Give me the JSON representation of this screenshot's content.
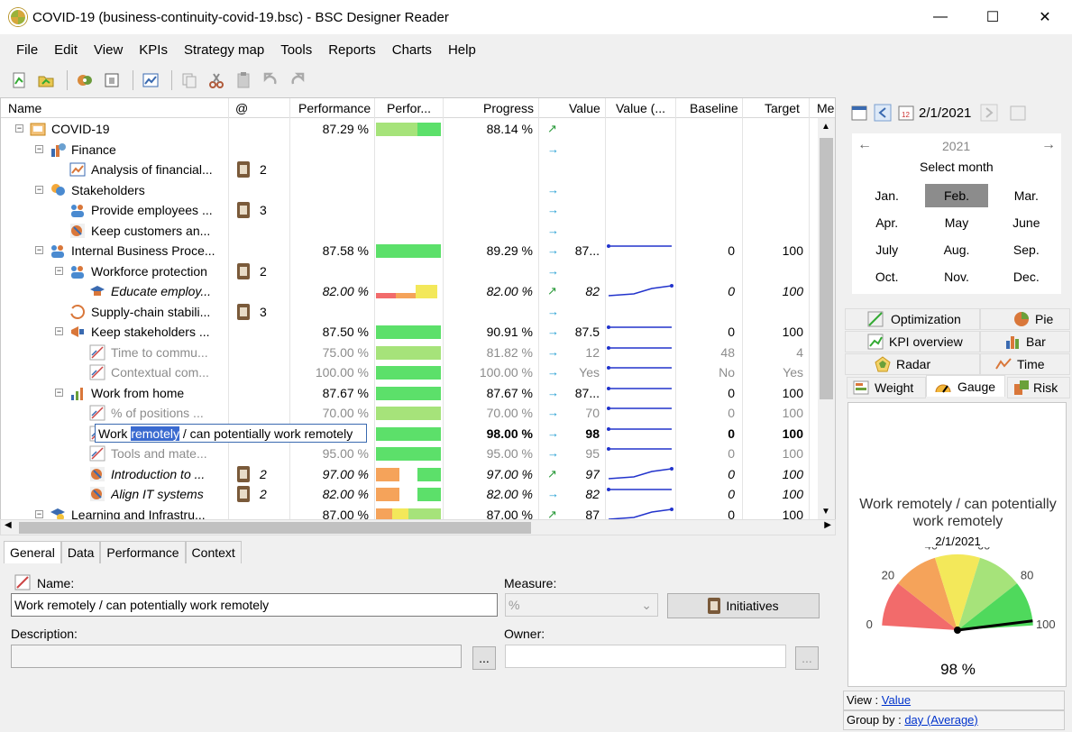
{
  "window": {
    "title": "COVID-19 (business-continuity-covid-19.bsc) - BSC Designer Reader",
    "controls": {
      "minimize": "—",
      "maximize": "☐",
      "close": "✕"
    }
  },
  "menu": [
    "File",
    "Edit",
    "View",
    "KPIs",
    "Strategy map",
    "Tools",
    "Reports",
    "Charts",
    "Help"
  ],
  "grid": {
    "headers": {
      "name": "Name",
      "at": "@",
      "performance": "Performance",
      "perf_bar": "Perfor...",
      "progress": "Progress",
      "value": "Value",
      "value_chart": "Value (...",
      "baseline": "Baseline",
      "target": "Target",
      "measure": "Mea"
    },
    "rows": [
      {
        "name": "COVID-19",
        "performance": "87.29 %",
        "progress": "88.14 %",
        "arrow": "↗",
        "value": "",
        "baseline": "",
        "target": "",
        "count": ""
      },
      {
        "name": "Finance",
        "performance": "",
        "progress": "",
        "arrow": "→",
        "value": "",
        "baseline": "",
        "target": "",
        "count": ""
      },
      {
        "name": "Analysis of financial...",
        "performance": "",
        "progress": "",
        "arrow": "",
        "value": "",
        "baseline": "",
        "target": "",
        "count": "2"
      },
      {
        "name": "Stakeholders",
        "performance": "",
        "progress": "",
        "arrow": "→",
        "value": "",
        "baseline": "",
        "target": "",
        "count": ""
      },
      {
        "name": "Provide employees ...",
        "performance": "",
        "progress": "",
        "arrow": "→",
        "value": "",
        "baseline": "",
        "target": "",
        "count": "3"
      },
      {
        "name": "Keep customers an...",
        "performance": "",
        "progress": "",
        "arrow": "→",
        "value": "",
        "baseline": "",
        "target": "",
        "count": ""
      },
      {
        "name": "Internal Business Proce...",
        "performance": "87.58 %",
        "progress": "89.29 %",
        "arrow": "→",
        "value": "87...",
        "baseline": "0",
        "target": "100",
        "count": ""
      },
      {
        "name": "Workforce protection",
        "performance": "",
        "progress": "",
        "arrow": "→",
        "value": "",
        "baseline": "",
        "target": "",
        "count": "2"
      },
      {
        "name": "Educate employ...",
        "performance": "82.00 %",
        "progress": "82.00 %",
        "arrow": "↗",
        "value": "82",
        "baseline": "0",
        "target": "100",
        "count": ""
      },
      {
        "name": "Supply-chain stabili...",
        "performance": "",
        "progress": "",
        "arrow": "→",
        "value": "",
        "baseline": "",
        "target": "",
        "count": "3"
      },
      {
        "name": "Keep stakeholders ...",
        "performance": "87.50 %",
        "progress": "90.91 %",
        "arrow": "→",
        "value": "87.5",
        "baseline": "0",
        "target": "100",
        "count": ""
      },
      {
        "name": "Time to commu...",
        "performance": "75.00 %",
        "progress": "81.82 %",
        "arrow": "→",
        "value": "12",
        "baseline": "48",
        "target": "4",
        "count": ""
      },
      {
        "name": "Contextual com...",
        "performance": "100.00 %",
        "progress": "100.00 %",
        "arrow": "→",
        "value": "Yes",
        "baseline": "No",
        "target": "Yes",
        "count": ""
      },
      {
        "name": "Work from home",
        "performance": "87.67 %",
        "progress": "87.67 %",
        "arrow": "→",
        "value": "87...",
        "baseline": "0",
        "target": "100",
        "count": ""
      },
      {
        "name": "% of positions ...",
        "performance": "70.00 %",
        "progress": "70.00 %",
        "arrow": "→",
        "value": "70",
        "baseline": "0",
        "target": "100",
        "count": ""
      },
      {
        "name": "Work remotely / can potentially work remotely",
        "performance": "",
        "progress": "98.00 %",
        "arrow": "→",
        "value": "98",
        "baseline": "0",
        "target": "100",
        "count": ""
      },
      {
        "name": "Tools and mate...",
        "performance": "95.00 %",
        "progress": "95.00 %",
        "arrow": "→",
        "value": "95",
        "baseline": "0",
        "target": "100",
        "count": ""
      },
      {
        "name": "Introduction to ...",
        "performance": "97.00 %",
        "progress": "97.00 %",
        "arrow": "↗",
        "value": "97",
        "baseline": "0",
        "target": "100",
        "count": "2"
      },
      {
        "name": "Align IT systems",
        "performance": "82.00 %",
        "progress": "82.00 %",
        "arrow": "→",
        "value": "82",
        "baseline": "0",
        "target": "100",
        "count": "2"
      },
      {
        "name": "Learning and Infrastru...",
        "performance": "87.00 %",
        "progress": "87.00 %",
        "arrow": "↗",
        "value": "87",
        "baseline": "0",
        "target": "100",
        "count": ""
      }
    ],
    "edit_highlight": "remotely"
  },
  "bottom_tabs": [
    "General",
    "Data",
    "Performance",
    "Context"
  ],
  "form": {
    "name_label": "Name:",
    "name_value": "Work remotely / can potentially work remotely",
    "measure_label": "Measure:",
    "measure_value": "%",
    "initiatives_label": "Initiatives",
    "description_label": "Description:",
    "owner_label": "Owner:",
    "ellipsis": "..."
  },
  "calendar": {
    "date": "2/1/2021",
    "year": "2021",
    "prev": "←",
    "next": "→",
    "caption": "Select month",
    "months": [
      "Jan.",
      "Feb.",
      "Mar.",
      "Apr.",
      "May",
      "June",
      "July",
      "Aug.",
      "Sep.",
      "Oct.",
      "Nov.",
      "Dec."
    ],
    "selected": "Feb."
  },
  "chart_tabs": [
    "Optimization",
    "Pie",
    "KPI overview",
    "Bar",
    "Radar",
    "Time",
    "Weight",
    "Gauge",
    "Risk"
  ],
  "gauge": {
    "title": "Work remotely / can potentially work remotely",
    "date": "2/1/2021",
    "value": 98,
    "value_label": "98 %",
    "ticks": [
      "0",
      "20",
      "40",
      "60",
      "80",
      "100"
    ],
    "colors": [
      "#f26b6b",
      "#f5a35a",
      "#f3e85a",
      "#a6e37a",
      "#4fd95c"
    ]
  },
  "footer": {
    "view_label": "View :",
    "view_value": "Value",
    "group_label": "Group by :",
    "group_value": "day (Average)"
  }
}
